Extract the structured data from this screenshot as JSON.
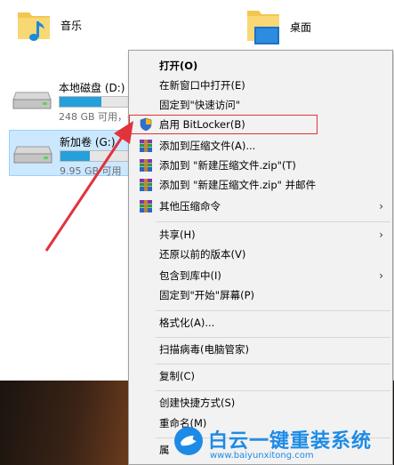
{
  "explorer": {
    "folders": [
      {
        "name": "音乐",
        "icon": "music-folder-icon"
      },
      {
        "name": "桌面",
        "icon": "desktop-folder-icon"
      }
    ],
    "drives": [
      {
        "name": "本地磁盘 (D:)",
        "free": "248 GB 可用，共",
        "used_fraction": 0.43,
        "selected": false
      },
      {
        "name": "新加卷 (G:)",
        "free": "9.95 GB 可用",
        "used_fraction": 0.3,
        "selected": true
      }
    ]
  },
  "context_menu": {
    "items": [
      {
        "label": "打开(O)",
        "bold": true
      },
      {
        "label": "在新窗口中打开(E)"
      },
      {
        "label": "固定到\"快速访问\""
      },
      {
        "label": "启用 BitLocker(B)",
        "icon": "shield-icon",
        "highlighted": true
      },
      {
        "label": "添加到压缩文件(A)...",
        "icon": "winrar-icon"
      },
      {
        "label": "添加到 \"新建压缩文件.zip\"(T)",
        "icon": "winrar-icon"
      },
      {
        "label": "添加到 \"新建压缩文件.zip\" 并邮件",
        "icon": "winrar-icon"
      },
      {
        "label": "其他压缩命令",
        "icon": "winrar-icon",
        "submenu": true
      },
      {
        "label": "共享(H)",
        "submenu": true
      },
      {
        "label": "还原以前的版本(V)"
      },
      {
        "label": "包含到库中(I)",
        "submenu": true
      },
      {
        "label": "固定到\"开始\"屏幕(P)"
      },
      {
        "label": "格式化(A)..."
      },
      {
        "label": "扫描病毒(电脑管家)"
      },
      {
        "label": "复制(C)"
      },
      {
        "label": "创建快捷方式(S)"
      },
      {
        "label": "重命名(M)"
      },
      {
        "label": "属"
      }
    ]
  },
  "watermark": {
    "title": "白云一键重装系统",
    "url": "www.baiyunxitong.com"
  },
  "colors": {
    "menu_bg": "#f2f2f2",
    "highlight_border": "#e0333a",
    "accent_blue": "#1d8be6",
    "drive_bar": "#26a0da"
  }
}
